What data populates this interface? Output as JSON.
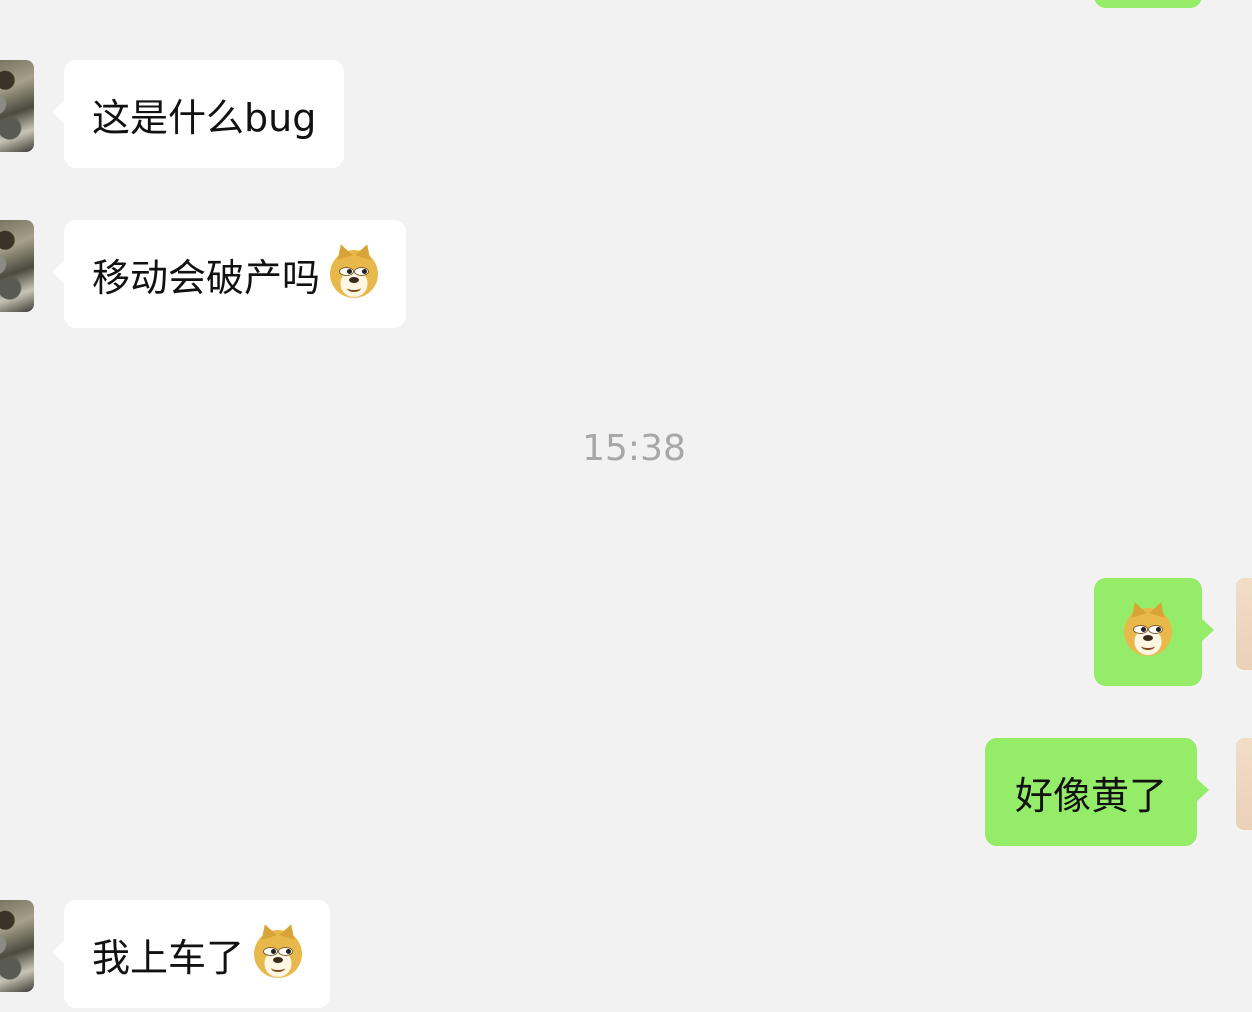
{
  "colors": {
    "background": "#f2f2f2",
    "incoming_bubble": "#ffffff",
    "outgoing_bubble": "#95ec69",
    "timestamp_text": "#a7a7a7"
  },
  "messages": [
    {
      "direction": "incoming",
      "text": "这是什么bug",
      "emoji": null
    },
    {
      "direction": "incoming",
      "text": "移动会破产吗",
      "emoji": "doge-emoji"
    },
    {
      "type": "timestamp",
      "text": "15:38"
    },
    {
      "direction": "outgoing",
      "text": "",
      "emoji": "doge-emoji"
    },
    {
      "direction": "outgoing",
      "text": "好像黄了",
      "emoji": null
    },
    {
      "direction": "incoming",
      "text": "我上车了",
      "emoji": "doge-emoji"
    }
  ]
}
